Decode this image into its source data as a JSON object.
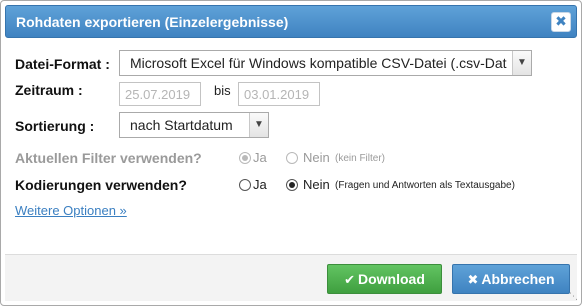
{
  "dialog": {
    "title": "Rohdaten exportieren (Einzelergebnisse)",
    "close_glyph": "✖"
  },
  "format": {
    "label": "Datei-Format :",
    "selected": "Microsoft Excel für Windows kompatible CSV-Datei (.csv-Dat"
  },
  "zeitraum": {
    "label": "Zeitraum :",
    "from": "25.07.2019",
    "bis_label": "bis",
    "to": "03.01.2019"
  },
  "sortierung": {
    "label": "Sortierung :",
    "selected": "nach Startdatum"
  },
  "filter": {
    "label": "Aktuellen Filter verwenden?",
    "ja": "Ja",
    "nein": "Nein",
    "nein_note": "(kein Filter)",
    "selected": "ja",
    "disabled": true
  },
  "kodierungen": {
    "label": "Kodierungen verwenden?",
    "ja": "Ja",
    "nein": "Nein",
    "nein_note": "(Fragen und Antworten als Textausgabe)",
    "selected": "nein"
  },
  "weitere_optionen": "Weitere Optionen »",
  "buttons": {
    "download": "Download",
    "download_icon": "check-icon",
    "cancel": "Abbrechen",
    "cancel_icon": "close-icon"
  },
  "colors": {
    "titlebar": "#4a8fcd",
    "download": "#4cae4c",
    "cancel": "#428bca",
    "link": "#3a7fc1"
  }
}
